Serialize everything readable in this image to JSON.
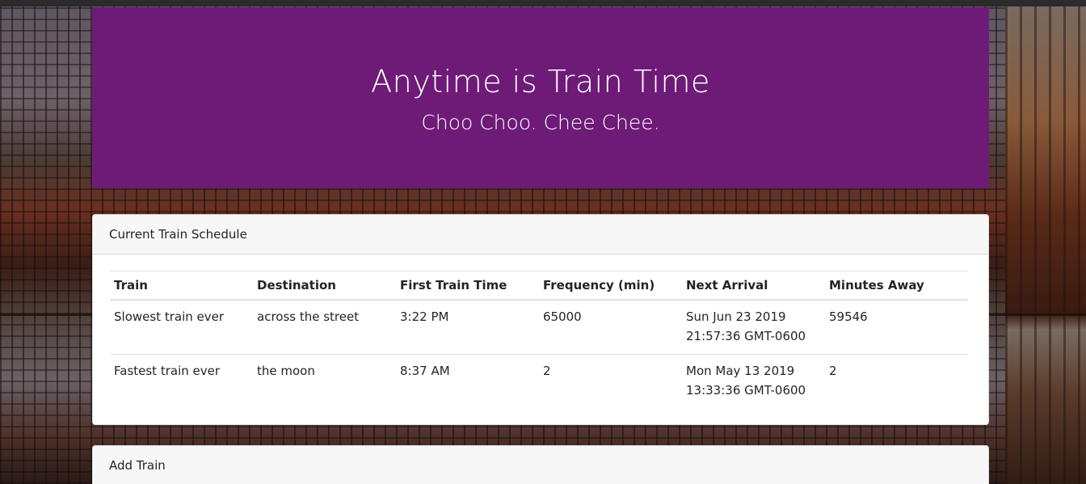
{
  "header": {
    "title": "Anytime is Train Time",
    "subtitle": "Choo Choo. Chee Chee."
  },
  "schedule": {
    "heading": "Current Train Schedule",
    "columns": [
      "Train",
      "Destination",
      "First Train Time",
      "Frequency (min)",
      "Next Arrival",
      "Minutes Away"
    ],
    "rows": [
      {
        "train": "Slowest train ever",
        "destination": "across the street",
        "first_time": "3:22 PM",
        "frequency": "65000",
        "next_arrival_line1": "Sun Jun 23 2019",
        "next_arrival_line2": "21:57:36 GMT-0600",
        "minutes_away": "59546"
      },
      {
        "train": "Fastest train ever",
        "destination": "the moon",
        "first_time": "8:37 AM",
        "frequency": "2",
        "next_arrival_line1": "Mon May 13 2019",
        "next_arrival_line2": "13:33:36 GMT-0600",
        "minutes_away": "2"
      }
    ]
  },
  "add_train": {
    "heading": "Add Train"
  },
  "colors": {
    "jumbotron_bg": "#6e1b78",
    "card_header_bg": "#f7f7f7"
  }
}
